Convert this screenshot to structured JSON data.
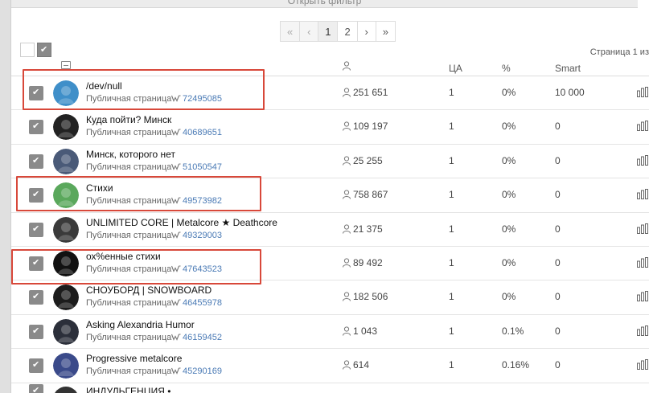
{
  "filter_bar": {
    "label": "Открыть фильтр"
  },
  "pagination": [
    {
      "label": "«",
      "state": "dim"
    },
    {
      "label": "‹",
      "state": "dim"
    },
    {
      "label": "1",
      "state": "active"
    },
    {
      "label": "2",
      "state": "normal"
    },
    {
      "label": "›",
      "state": "normal"
    },
    {
      "label": "»",
      "state": "normal"
    }
  ],
  "page_info": "Страница 1 из",
  "columns": {
    "ca": "ЦА",
    "pct": "%",
    "smart": "Smart"
  },
  "rows": [
    {
      "name": "/dev/null",
      "type": "Публичная страница",
      "id": "72495085",
      "subs": "251 651",
      "ca": "1",
      "pct": "0%",
      "smart": "10 000",
      "avatar": "#3f8fc9",
      "highlight": true
    },
    {
      "name": "Куда пойти? Минск",
      "type": "Публичная страница",
      "id": "40689651",
      "subs": "109 197",
      "ca": "1",
      "pct": "0%",
      "smart": "0",
      "avatar": "#222222",
      "highlight": false
    },
    {
      "name": "Минск, которого нет",
      "type": "Публичная страница",
      "id": "51050547",
      "subs": "25 255",
      "ca": "1",
      "pct": "0%",
      "smart": "0",
      "avatar": "#4a5a78",
      "highlight": false
    },
    {
      "name": "Стихи",
      "type": "Публичная страница",
      "id": "49573982",
      "subs": "758 867",
      "ca": "1",
      "pct": "0%",
      "smart": "0",
      "avatar": "#5aa85c",
      "highlight": true
    },
    {
      "name": "UNLIMITED CORE | Metalcore ★ Deathcore",
      "type": "Публичная страница",
      "id": "49329003",
      "subs": "21 375",
      "ca": "1",
      "pct": "0%",
      "smart": "0",
      "avatar": "#3a3a3a",
      "highlight": false
    },
    {
      "name": "ох%енные стихи",
      "type": "Публичная страница",
      "id": "47643523",
      "subs": "89 492",
      "ca": "1",
      "pct": "0%",
      "smart": "0",
      "avatar": "#111111",
      "highlight": true
    },
    {
      "name": "СНОУБОРД | SNOWBOARD",
      "type": "Публичная страница",
      "id": "46455978",
      "subs": "182 506",
      "ca": "1",
      "pct": "0%",
      "smart": "0",
      "avatar": "#1c1c1c",
      "highlight": false
    },
    {
      "name": "Asking Alexandria Humor",
      "type": "Публичная страница",
      "id": "46159452",
      "subs": "1 043",
      "ca": "1",
      "pct": "0.1%",
      "smart": "0",
      "avatar": "#2b2f3a",
      "highlight": false
    },
    {
      "name": "Progressive metalcore",
      "type": "Публичная страница",
      "id": "45290169",
      "subs": "614",
      "ca": "1",
      "pct": "0.16%",
      "smart": "0",
      "avatar": "#3a4a8a",
      "highlight": false
    }
  ],
  "partial_next_row": {
    "name": "ИНДУЛЬГЕНЦИЯ •"
  },
  "colors": {
    "highlight": "#d8483a",
    "link": "#4a7ab5",
    "checkbox": "#8a8a8a"
  }
}
